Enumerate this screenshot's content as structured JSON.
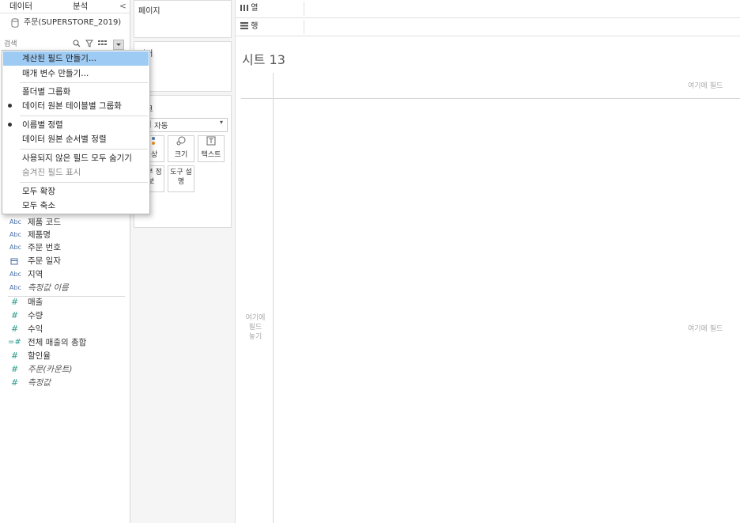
{
  "left_pane": {
    "tabs": {
      "data": "데이터",
      "analysis": "분석",
      "collapse_glyph": "<"
    },
    "datasource": "주문(SUPERSTORE_2019)",
    "search": {
      "placeholder": "검색"
    },
    "fields": [
      {
        "type": "Abc",
        "label": "제품 코드",
        "italic": false
      },
      {
        "type": "Abc",
        "label": "제품명",
        "italic": false
      },
      {
        "type": "Abc",
        "label": "주문 번호",
        "italic": false
      },
      {
        "type": "date",
        "label": "주문 일자",
        "italic": false
      },
      {
        "type": "Abc",
        "label": "지역",
        "italic": false
      },
      {
        "type": "Abc",
        "label": "측정값 이름",
        "italic": true
      }
    ],
    "measures": [
      {
        "type": "#",
        "label": "매출",
        "italic": false
      },
      {
        "type": "#",
        "label": "수량",
        "italic": false
      },
      {
        "type": "#",
        "label": "수익",
        "italic": false
      },
      {
        "type": "=#",
        "label": "전체 매출의 총합",
        "italic": false
      },
      {
        "type": "#",
        "label": "할인율",
        "italic": false
      },
      {
        "type": "#",
        "label": "주문(카운트)",
        "italic": true
      },
      {
        "type": "#",
        "label": "측정값",
        "italic": true
      }
    ]
  },
  "shelves": {
    "pages": "페이지",
    "filters": "필터",
    "marks": "마크",
    "mark_type": "자동",
    "mark_buttons": {
      "color": "색상",
      "size": "크기",
      "text": "텍스트",
      "detail": "세부 정보",
      "tooltip": "도구 설명"
    },
    "columns": "열",
    "rows": "행"
  },
  "sheet": {
    "title": "시트 13",
    "drop_top": "여기에 필드",
    "drop_left": "여기에\n필드\n놓기",
    "drop_center": "여기에 필드"
  },
  "context_menu": {
    "items": [
      {
        "label": "계산된 필드 만들기...",
        "highlighted": true
      },
      {
        "label": "매개 변수 만들기..."
      },
      {
        "label": "폴더별 그룹화"
      },
      {
        "label": "데이터 원본 테이블별 그룹화",
        "checked": true
      },
      {
        "label": "이름별 정렬",
        "checked": true
      },
      {
        "label": "데이터 원본 순서별 정렬"
      },
      {
        "label": "사용되지 않은 필드 모두 숨기기"
      },
      {
        "label": "숨겨진 필드 표시",
        "disabled": true
      },
      {
        "label": "모두 확장"
      },
      {
        "label": "모두 축소"
      }
    ]
  },
  "colors": {
    "highlight": "#9ecbf3",
    "dimension_icon": "#4a6fa5",
    "measure_icon": "#2a9b8a"
  }
}
